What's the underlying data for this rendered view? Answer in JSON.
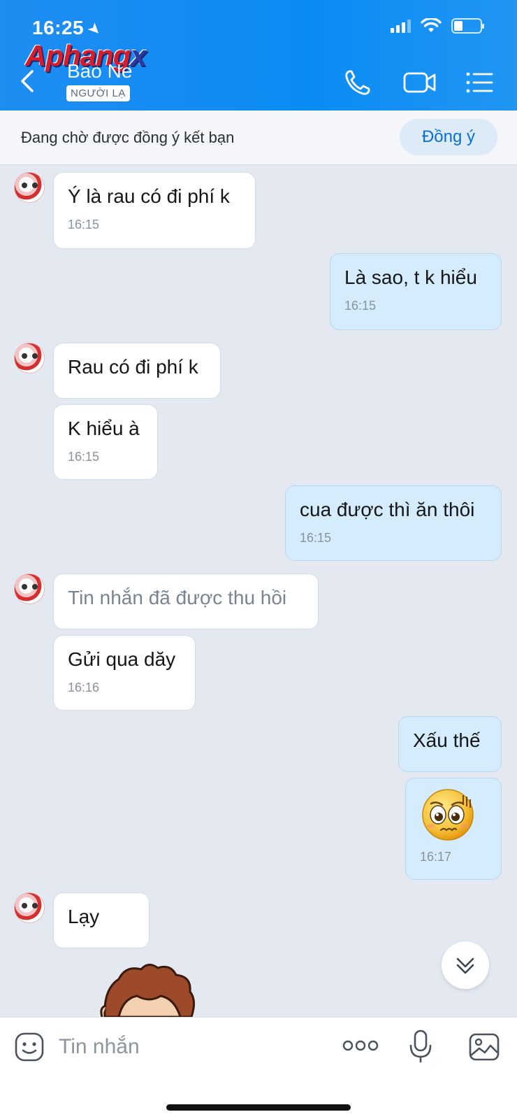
{
  "status_bar": {
    "time": "16:25"
  },
  "watermark": {
    "text_a": "Aphang",
    "text_b": "x"
  },
  "header": {
    "contact_name": "Bao Ne",
    "badge": "NGƯỜI LẠ",
    "icons": [
      "back-icon",
      "phone-icon",
      "video-icon",
      "menu-icon"
    ]
  },
  "friend_request": {
    "text": "Đang chờ được đồng ý kết bạn",
    "accept_label": "Đồng ý"
  },
  "messages": [
    {
      "side": "in",
      "text": "Ý là rau có đi phí k",
      "time": "16:15"
    },
    {
      "side": "out",
      "text": "Là sao, t k hiểu",
      "time": "16:15"
    },
    {
      "side": "in",
      "text": "Rau có đi phí k",
      "time": ""
    },
    {
      "side": "in",
      "text": "K hiểu à",
      "time": "16:15"
    },
    {
      "side": "out",
      "text": "cua được thì ăn thôi",
      "time": "16:15"
    },
    {
      "side": "in",
      "text": "Tin nhắn đã được thu hồi",
      "time": "",
      "recalled": true
    },
    {
      "side": "in",
      "text": "Gửi qua dăy",
      "time": "16:16"
    },
    {
      "side": "out",
      "text": "Xấu thế",
      "time": ""
    },
    {
      "side": "out",
      "text": "",
      "time": "16:17",
      "sticker": "pleading-face-emoji"
    },
    {
      "side": "in",
      "text": "Lạy",
      "time": ""
    }
  ],
  "input": {
    "placeholder": "Tin nhắn"
  },
  "colors": {
    "header_blue": "#0a8cf5",
    "incoming_bubble": "#ffffff",
    "outgoing_bubble": "#d4ecfc",
    "chat_background": "#e3e8f1",
    "accent": "#0b6fd4"
  }
}
